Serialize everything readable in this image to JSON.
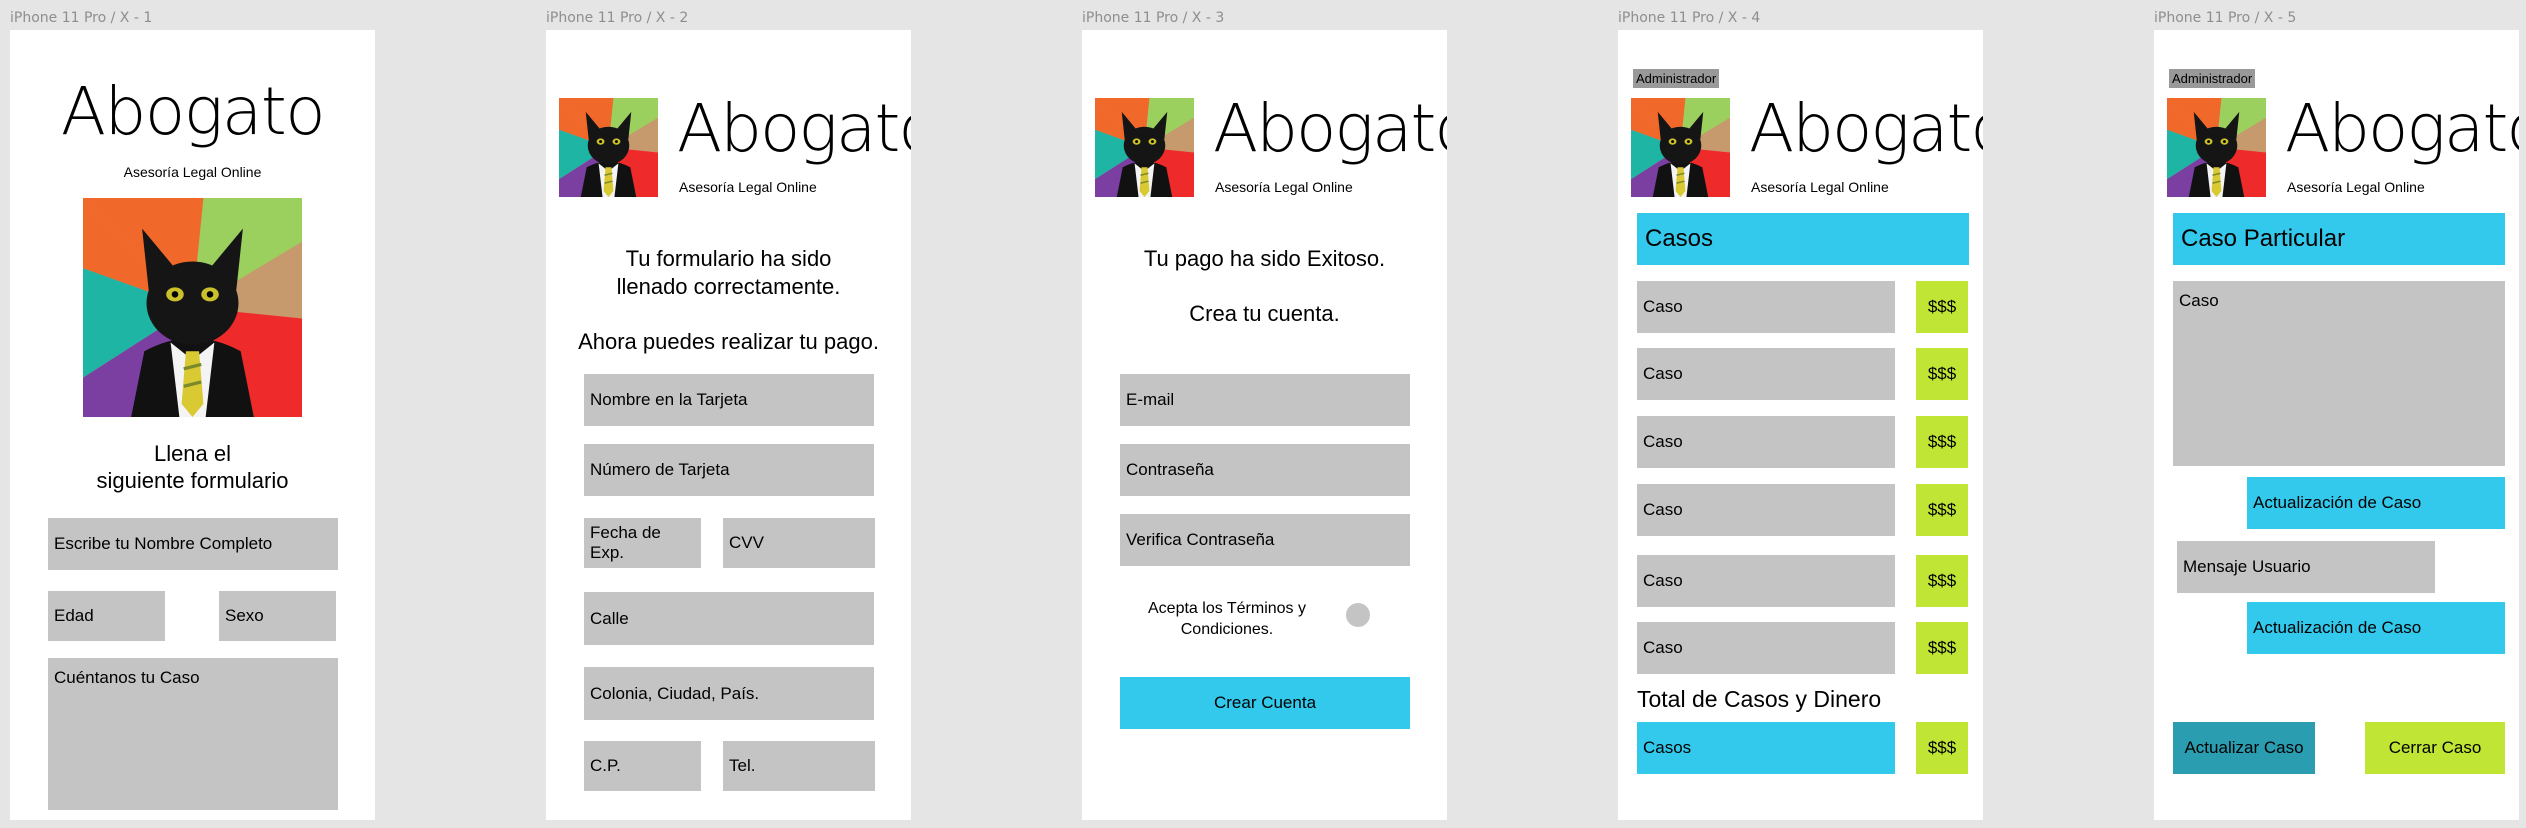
{
  "frames": [
    {
      "label": "iPhone 11 Pro / X - 1"
    },
    {
      "label": "iPhone 11 Pro / X - 2"
    },
    {
      "label": "iPhone 11 Pro / X - 3"
    },
    {
      "label": "iPhone 11 Pro / X - 4"
    },
    {
      "label": "iPhone 11 Pro / X - 5"
    }
  ],
  "brand": {
    "name": "Abogato",
    "tagline": "Asesoría Legal Online"
  },
  "icons": {
    "logo": "business-cat-logo-icon"
  },
  "colors": {
    "cyan": "#33c9ec",
    "lime": "#c0e534",
    "gray": "#c4c4c4",
    "teal": "#2b9db1"
  },
  "screen1": {
    "heading_line1": "Llena el",
    "heading_line2": "siguiente formulario",
    "name_placeholder": "Escribe tu Nombre Completo",
    "age_placeholder": "Edad",
    "sex_placeholder": "Sexo",
    "case_placeholder": "Cuéntanos tu Caso"
  },
  "screen2": {
    "msg_line1": "Tu formulario ha sido",
    "msg_line2": "llenado correctamente.",
    "msg_line3": "Ahora puedes realizar tu pago.",
    "card_name": "Nombre en la Tarjeta",
    "card_number": "Número de Tarjeta",
    "exp_date": "Fecha de Exp.",
    "cvv": "CVV",
    "street": "Calle",
    "colony": "Colonia, Ciudad, País.",
    "zip": "C.P.",
    "phone": "Tel."
  },
  "screen3": {
    "msg_line1": "Tu pago ha sido Exitoso.",
    "msg_line2": "Crea tu cuenta.",
    "email": "E-mail",
    "password": "Contraseña",
    "confirm_password": "Verifica Contraseña",
    "terms_line1": "Acepta los Términos y",
    "terms_line2": "Condiciones.",
    "create_button": "Crear Cuenta"
  },
  "screen4": {
    "admin": "Administrador",
    "section_title": "Casos",
    "cases": [
      {
        "label": "Caso",
        "amount": "$$$"
      },
      {
        "label": "Caso",
        "amount": "$$$"
      },
      {
        "label": "Caso",
        "amount": "$$$"
      },
      {
        "label": "Caso",
        "amount": "$$$"
      },
      {
        "label": "Caso",
        "amount": "$$$"
      },
      {
        "label": "Caso",
        "amount": "$$$"
      }
    ],
    "total_title": "Total de Casos y Dinero",
    "total_label": "Casos",
    "total_amount": "$$$"
  },
  "screen5": {
    "admin": "Administrador",
    "section_title": "Caso Particular",
    "case_text": "Caso",
    "update1": "Actualización de Caso",
    "user_message": "Mensaje Usuario",
    "update2": "Actualización de Caso",
    "update_button": "Actualizar Caso",
    "close_button": "Cerrar Caso"
  }
}
